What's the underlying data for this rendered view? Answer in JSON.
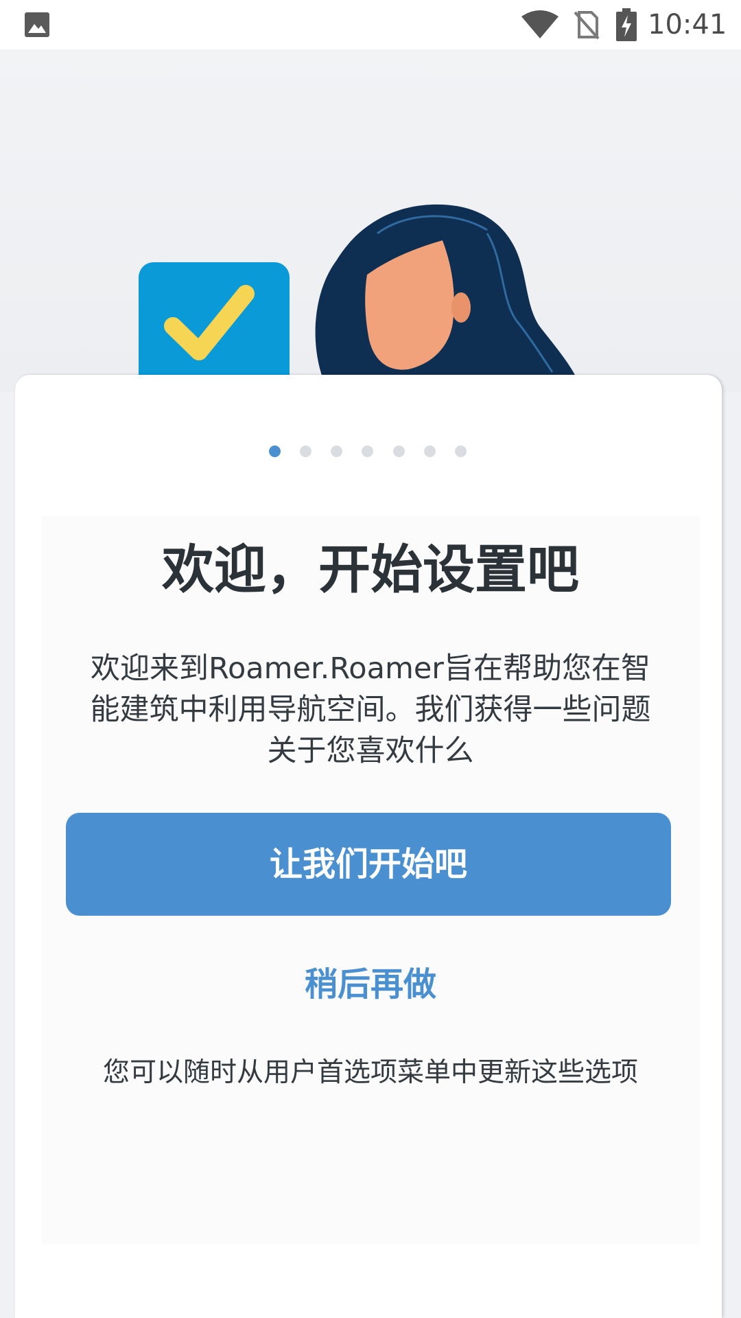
{
  "status_bar": {
    "time": "10:41",
    "icons": [
      "gallery-icon",
      "wifi-icon",
      "no-sim-icon",
      "battery-charging-icon"
    ]
  },
  "illustration": {
    "icons": [
      "checkbox-checked-icon",
      "woman-avatar-illustration"
    ],
    "colors": {
      "checkbox": "#0a9ad8",
      "checkmark": "#f6d454",
      "hair": "#0f2f52",
      "skin": "#f1a27a"
    }
  },
  "pager": {
    "count": 7,
    "active_index": 0
  },
  "welcome": {
    "title": "欢迎，开始设置吧",
    "description": "欢迎来到Roamer.Roamer旨在帮助您在智能建筑中利用导航空间。我们获得一些问题关于您喜欢什么"
  },
  "actions": {
    "start_label": "让我们开始吧",
    "later_label": "稍后再做"
  },
  "footnote": "您可以随时从用户首选项菜单中更新这些选项",
  "colors": {
    "accent": "#4a90d0",
    "text": "#2b3238",
    "background": "#eff1f4"
  }
}
